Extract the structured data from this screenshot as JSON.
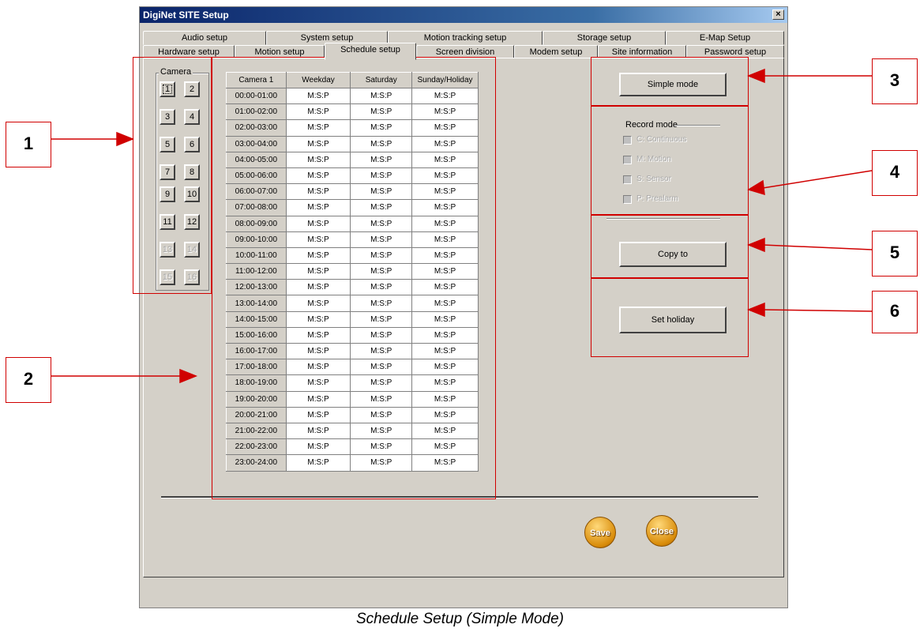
{
  "window": {
    "title": "DigiNet SITE Setup",
    "close_glyph": "×"
  },
  "tabs_row1": [
    "Audio setup",
    "System setup",
    "Motion tracking setup",
    "Storage setup",
    "E-Map Setup"
  ],
  "tabs_row2": [
    "Hardware setup",
    "Motion setup",
    "Schedule setup",
    "Screen division",
    "Modem setup",
    "Site information",
    "Password setup"
  ],
  "active_tab": "Schedule setup",
  "camera_group": {
    "label": "Camera",
    "buttons": [
      "1",
      "2",
      "3",
      "4",
      "5",
      "6",
      "7",
      "8",
      "9",
      "10",
      "11",
      "12",
      "13",
      "14",
      "15",
      "16"
    ],
    "selected": "1",
    "disabled": [
      "13",
      "14",
      "15",
      "16"
    ]
  },
  "schedule": {
    "headers": [
      "Camera 1",
      "Weekday",
      "Saturday",
      "Sunday/Holiday"
    ],
    "rows": [
      [
        "00:00-01:00",
        "M:S:P",
        "M:S:P",
        "M:S:P"
      ],
      [
        "01:00-02:00",
        "M:S:P",
        "M:S:P",
        "M:S:P"
      ],
      [
        "02:00-03:00",
        "M:S:P",
        "M:S:P",
        "M:S:P"
      ],
      [
        "03:00-04:00",
        "M:S:P",
        "M:S:P",
        "M:S:P"
      ],
      [
        "04:00-05:00",
        "M:S:P",
        "M:S:P",
        "M:S:P"
      ],
      [
        "05:00-06:00",
        "M:S:P",
        "M:S:P",
        "M:S:P"
      ],
      [
        "06:00-07:00",
        "M:S:P",
        "M:S:P",
        "M:S:P"
      ],
      [
        "07:00-08:00",
        "M:S:P",
        "M:S:P",
        "M:S:P"
      ],
      [
        "08:00-09:00",
        "M:S:P",
        "M:S:P",
        "M:S:P"
      ],
      [
        "09:00-10:00",
        "M:S:P",
        "M:S:P",
        "M:S:P"
      ],
      [
        "10:00-11:00",
        "M:S:P",
        "M:S:P",
        "M:S:P"
      ],
      [
        "11:00-12:00",
        "M:S:P",
        "M:S:P",
        "M:S:P"
      ],
      [
        "12:00-13:00",
        "M:S:P",
        "M:S:P",
        "M:S:P"
      ],
      [
        "13:00-14:00",
        "M:S:P",
        "M:S:P",
        "M:S:P"
      ],
      [
        "14:00-15:00",
        "M:S:P",
        "M:S:P",
        "M:S:P"
      ],
      [
        "15:00-16:00",
        "M:S:P",
        "M:S:P",
        "M:S:P"
      ],
      [
        "16:00-17:00",
        "M:S:P",
        "M:S:P",
        "M:S:P"
      ],
      [
        "17:00-18:00",
        "M:S:P",
        "M:S:P",
        "M:S:P"
      ],
      [
        "18:00-19:00",
        "M:S:P",
        "M:S:P",
        "M:S:P"
      ],
      [
        "19:00-20:00",
        "M:S:P",
        "M:S:P",
        "M:S:P"
      ],
      [
        "20:00-21:00",
        "M:S:P",
        "M:S:P",
        "M:S:P"
      ],
      [
        "21:00-22:00",
        "M:S:P",
        "M:S:P",
        "M:S:P"
      ],
      [
        "22:00-23:00",
        "M:S:P",
        "M:S:P",
        "M:S:P"
      ],
      [
        "23:00-24:00",
        "M:S:P",
        "M:S:P",
        "M:S:P"
      ]
    ]
  },
  "right_panel": {
    "simple_mode_label": "Simple mode",
    "record_mode_label": "Record mode",
    "record_options": [
      "C: Continuous",
      "M: Motion",
      "S: Sensor",
      "P: Prealarm"
    ],
    "copy_to_label": "Copy to",
    "set_holiday_label": "Set holiday"
  },
  "footer_buttons": {
    "save": "Save",
    "close": "Close"
  },
  "callouts": [
    "1",
    "2",
    "3",
    "4",
    "5",
    "6"
  ],
  "caption": "Schedule Setup (Simple Mode)",
  "colors": {
    "annotation": "#d00000",
    "titlebar": "#0a246a",
    "dialog": "#d4d0c8",
    "round_button": "#d98c0a"
  }
}
